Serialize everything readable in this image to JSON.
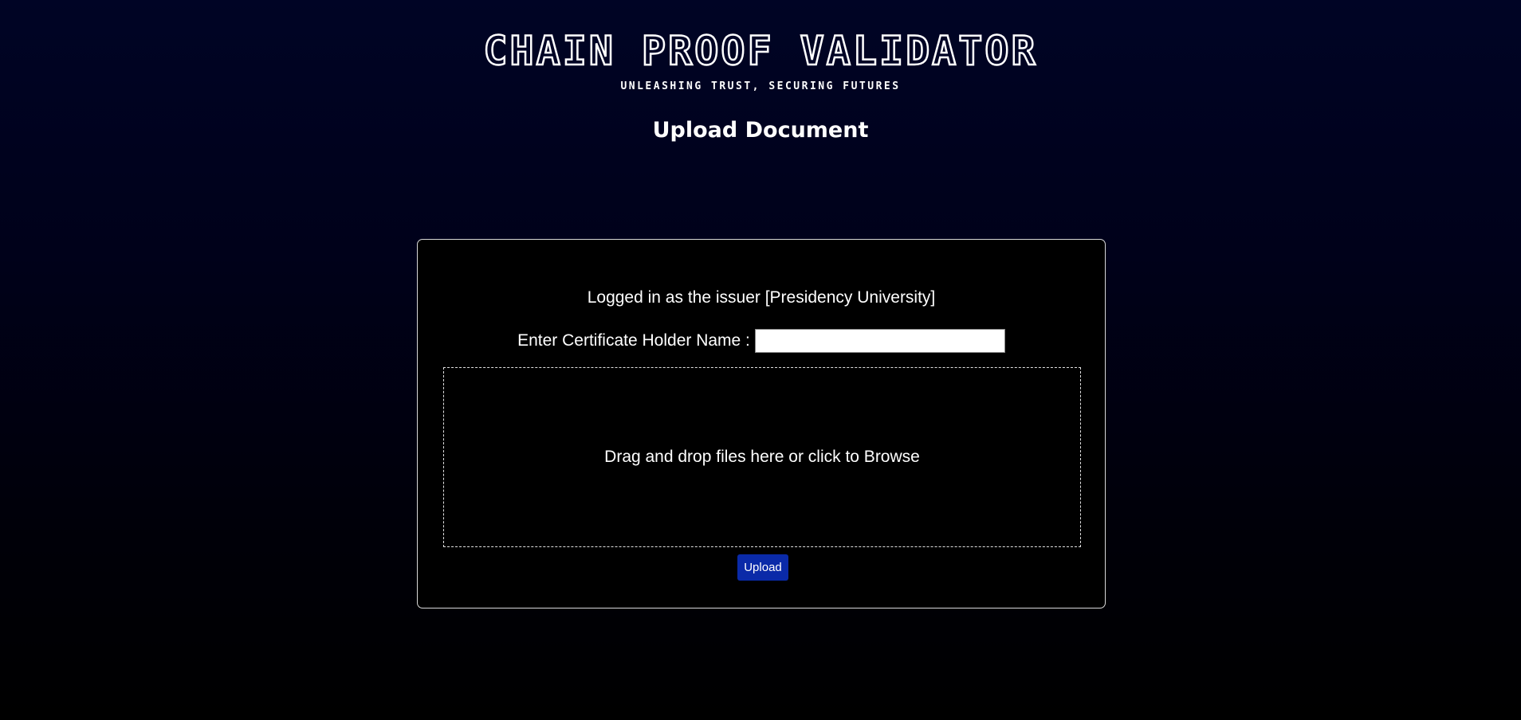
{
  "header": {
    "title": "CHAIN PROOF VALIDATOR",
    "tagline": "UNLEASHING TRUST, SECURING FUTURES"
  },
  "page": {
    "heading": "Upload Document"
  },
  "card": {
    "issuer_text": "Logged in as the issuer [Presidency University]",
    "name_label": "Enter Certificate Holder Name :",
    "name_value": "",
    "dropzone_text": "Drag and drop files here or click to Browse",
    "upload_label": "Upload"
  },
  "colors": {
    "background_top": "#000425",
    "background_bottom": "#000000",
    "upload_button": "#0a2aa8",
    "text": "#ffffff"
  }
}
